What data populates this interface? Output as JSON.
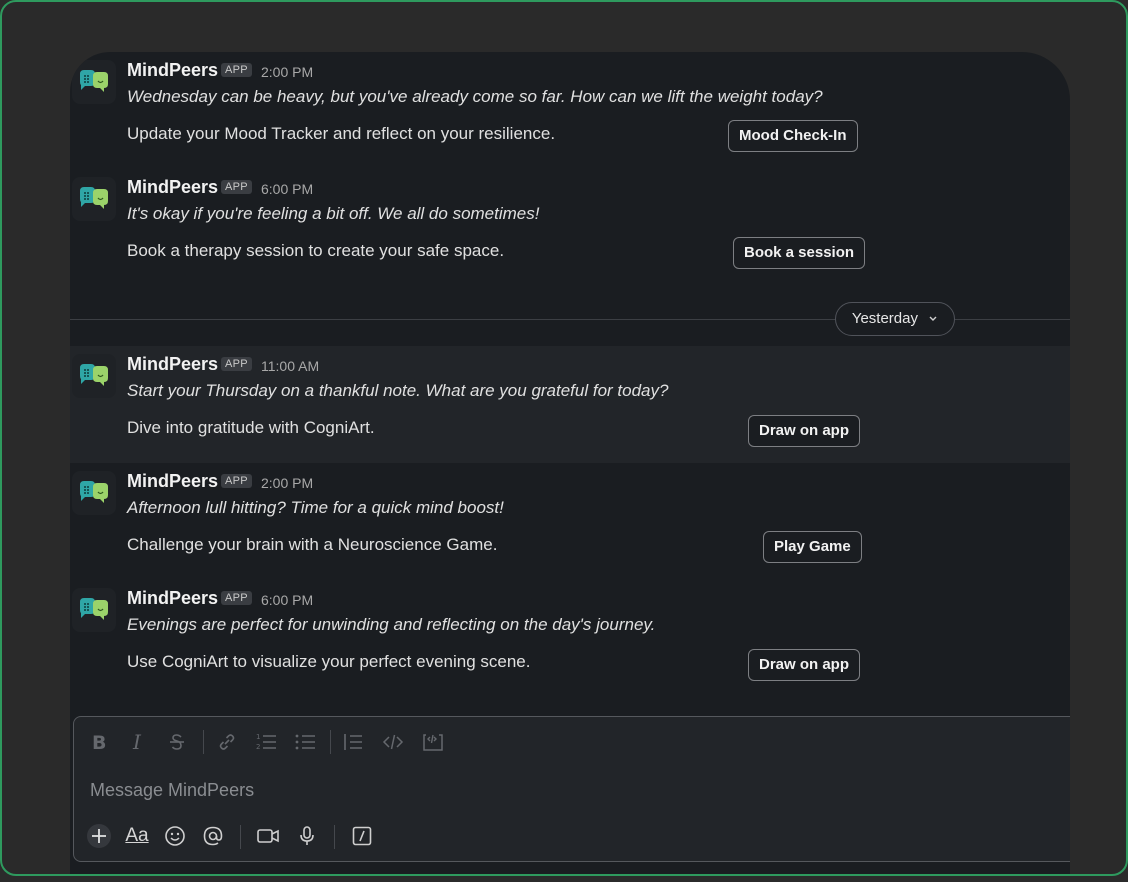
{
  "app": {
    "name": "MindPeers",
    "tag": "APP"
  },
  "messages": [
    {
      "time": "2:00 PM",
      "italic": "Wednesday can be heavy, but you've already come so far. How can we lift the weight today?",
      "body": "Update your Mood Tracker and reflect on your resilience.",
      "button": "Mood Check-In"
    },
    {
      "time": "6:00 PM",
      "italic": "It's okay if you're feeling a bit off. We all do sometimes!",
      "body": "Book a therapy session to create your safe space.",
      "button": "Book a session"
    },
    {
      "time": "11:00 AM",
      "italic": "Start your Thursday on a thankful note. What are you grateful for today?",
      "body": "Dive into gratitude with CogniArt.",
      "button": "Draw on app"
    },
    {
      "time": "2:00 PM",
      "italic": "Afternoon lull hitting? Time for a quick mind boost!",
      "body": "Challenge your brain with a Neuroscience Game.",
      "button": "Play Game"
    },
    {
      "time": "6:00 PM",
      "italic": "Evenings are perfect for unwinding and reflecting on the day's journey.",
      "body": "Use CogniArt to visualize your perfect evening scene.",
      "button": "Draw on app"
    }
  ],
  "divider": {
    "label": "Yesterday"
  },
  "composer": {
    "placeholder": "Message MindPeers",
    "text_format_label": "Aa"
  },
  "colors": {
    "frame_border": "#2e9a5e",
    "background": "#1a1d21",
    "highlight": "#222529"
  }
}
